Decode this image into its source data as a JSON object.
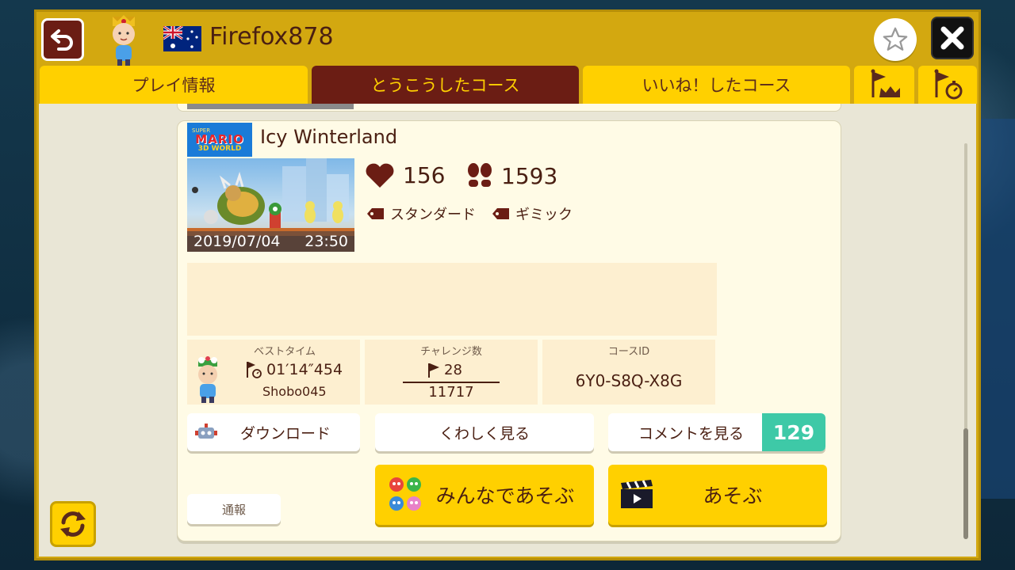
{
  "header": {
    "username": "Firefox878"
  },
  "tabs": [
    {
      "label": "プレイ情報"
    },
    {
      "label": "とうこうしたコース"
    },
    {
      "label": "いいね！したコース"
    }
  ],
  "course": {
    "game_logo": {
      "line1": "SUPER",
      "line2": "MARIO",
      "line3": "3D WORLD"
    },
    "title": "Icy Winterland",
    "upload_date": "2019/07/04",
    "upload_time": "23:50",
    "likes": "156",
    "plays": "1593",
    "tags": [
      "スタンダード",
      "ギミック"
    ],
    "best_time": {
      "header": "ベストタイム",
      "time": "01′14″454",
      "holder": "Shobo045"
    },
    "challenges": {
      "header": "チャレンジ数",
      "clears": "28",
      "attempts": "11717"
    },
    "course_id": {
      "header": "コースID",
      "value": "6Y0-S8Q-X8G"
    }
  },
  "buttons": {
    "download": "ダウンロード",
    "details": "くわしく見る",
    "comments": "コメントを見る",
    "comment_count": "129",
    "report": "通報",
    "multiplayer": "みんなであそぶ",
    "play": "あそぶ"
  },
  "colors": {
    "frame": "#d3a810",
    "tab": "#ffd000",
    "tab_active": "#6b1d14",
    "text": "#4a1f12",
    "card": "#fffbe6",
    "comment_badge": "#3ec9a7"
  }
}
